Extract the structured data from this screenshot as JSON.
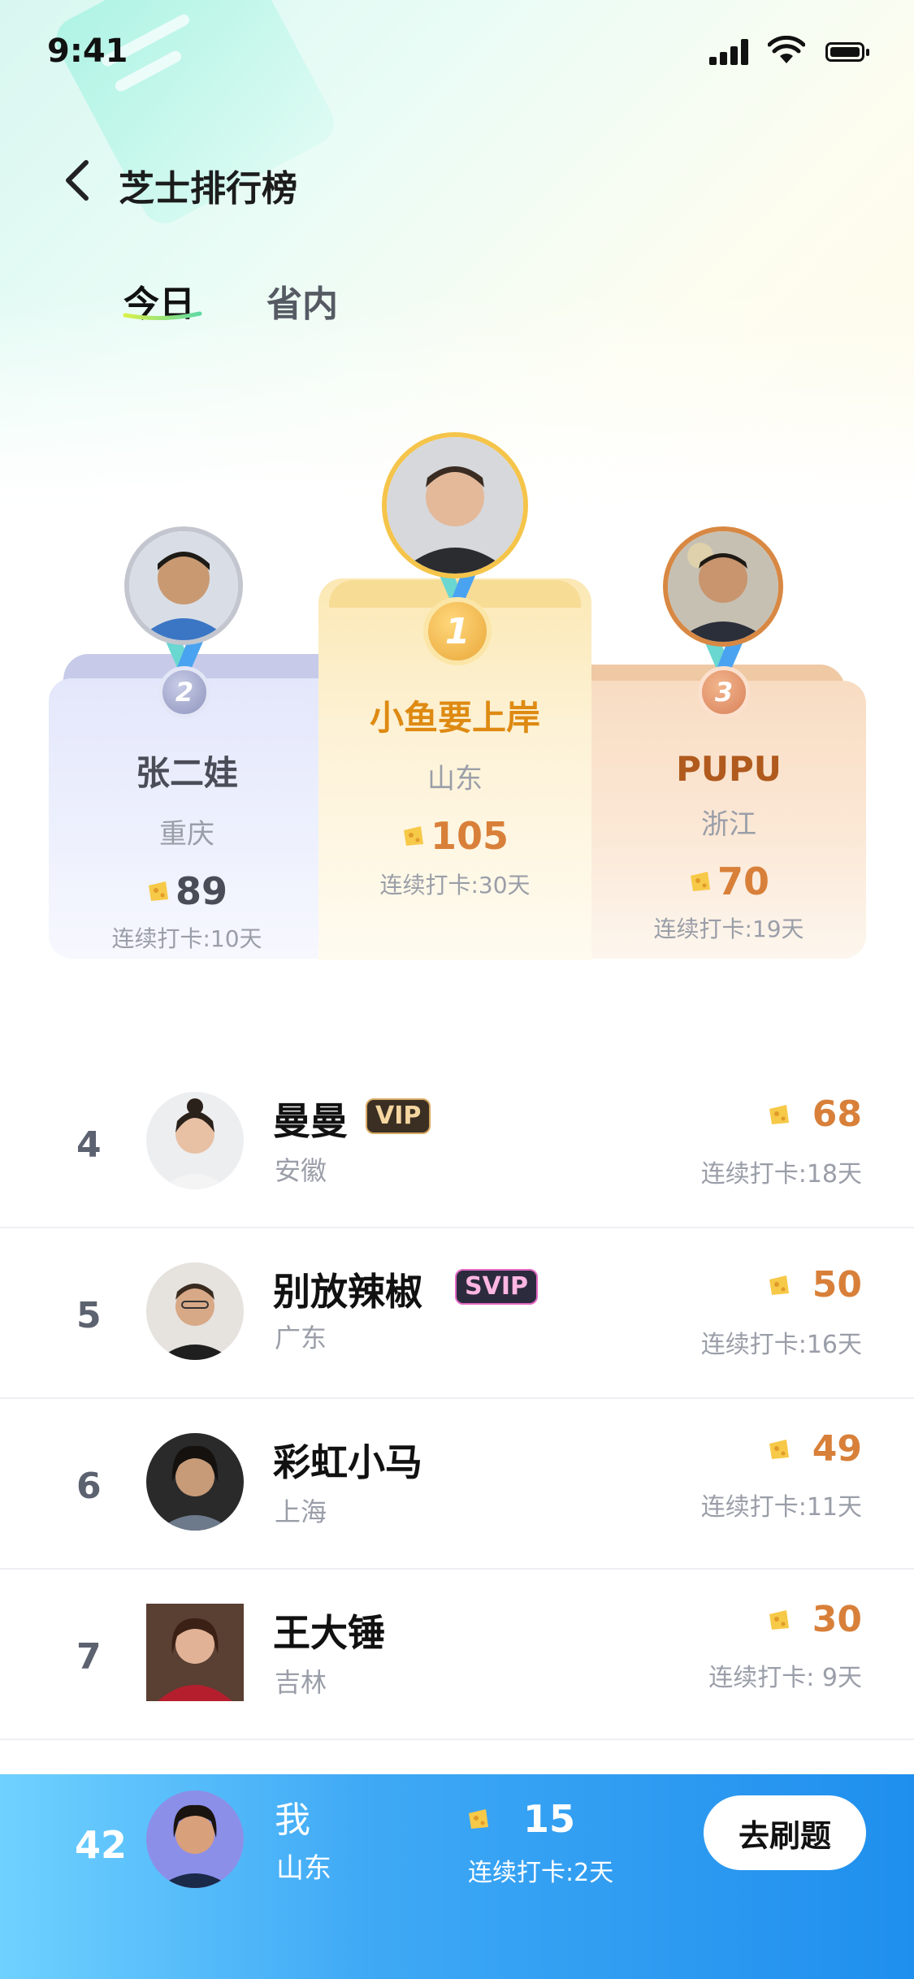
{
  "status_bar": {
    "time": "9:41"
  },
  "header": {
    "title": "芝士排行榜"
  },
  "tabs": [
    {
      "label": "今日",
      "active": true
    },
    {
      "label": "省内",
      "active": false
    }
  ],
  "podium": {
    "first": {
      "rank": "1",
      "name": "小鱼要上岸",
      "province": "山东",
      "score": "105",
      "streak": "连续打卡:30天"
    },
    "second": {
      "rank": "2",
      "name": "张二娃",
      "province": "重庆",
      "score": "89",
      "streak": "连续打卡:10天"
    },
    "third": {
      "rank": "3",
      "name": "PUPU",
      "province": "浙江",
      "score": "70",
      "streak": "连续打卡:19天"
    }
  },
  "list": [
    {
      "rank": "4",
      "name": "曼曼",
      "badge": "VIP",
      "province": "安徽",
      "score": "68",
      "streak": "连续打卡:18天"
    },
    {
      "rank": "5",
      "name": "别放辣椒",
      "badge": "SVIP",
      "province": "广东",
      "score": "50",
      "streak": "连续打卡:16天"
    },
    {
      "rank": "6",
      "name": "彩虹小马",
      "badge": "",
      "province": "上海",
      "score": "49",
      "streak": "连续打卡:11天"
    },
    {
      "rank": "7",
      "name": "王大锤",
      "badge": "",
      "province": "吉林",
      "score": "30",
      "streak": "连续打卡: 9天"
    }
  ],
  "me": {
    "rank": "42",
    "name": "我",
    "province": "山东",
    "score": "15",
    "streak": "连续打卡:2天",
    "button": "去刷题"
  },
  "colors": {
    "accent_blue": "#1f8fee",
    "gold": "#f5c44a",
    "score_orange": "#d8803a"
  }
}
